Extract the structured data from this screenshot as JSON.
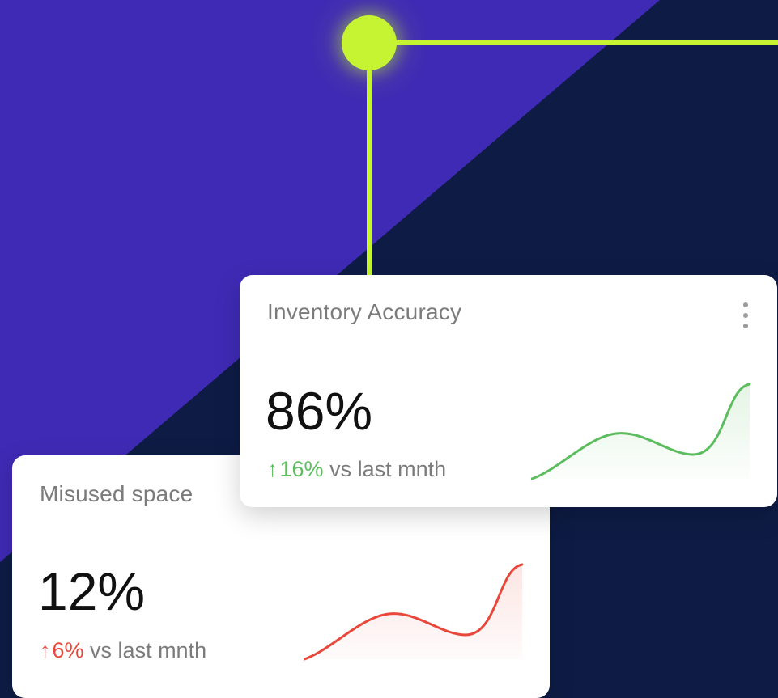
{
  "colors": {
    "background_dark": "#0e1c45",
    "background_purple": "#3f2ab5",
    "accent_lime": "#c6f432",
    "positive_green": "#5cbd5e",
    "negative_red": "#e8473a"
  },
  "cards": [
    {
      "title": "Inventory Accuracy",
      "value": "86%",
      "trend_icon": "arrow-up-icon",
      "trend_arrow": "↑",
      "trend_value": "16%",
      "trend_text": "vs last mnth",
      "trend_color": "#5cbd5e",
      "menu_icon": "kebab-menu-icon"
    },
    {
      "title": "Misused space",
      "value": "12%",
      "trend_icon": "arrow-up-icon",
      "trend_arrow": "↑",
      "trend_value": "6%",
      "trend_text": "vs last mnth",
      "trend_color": "#e8473a"
    }
  ]
}
